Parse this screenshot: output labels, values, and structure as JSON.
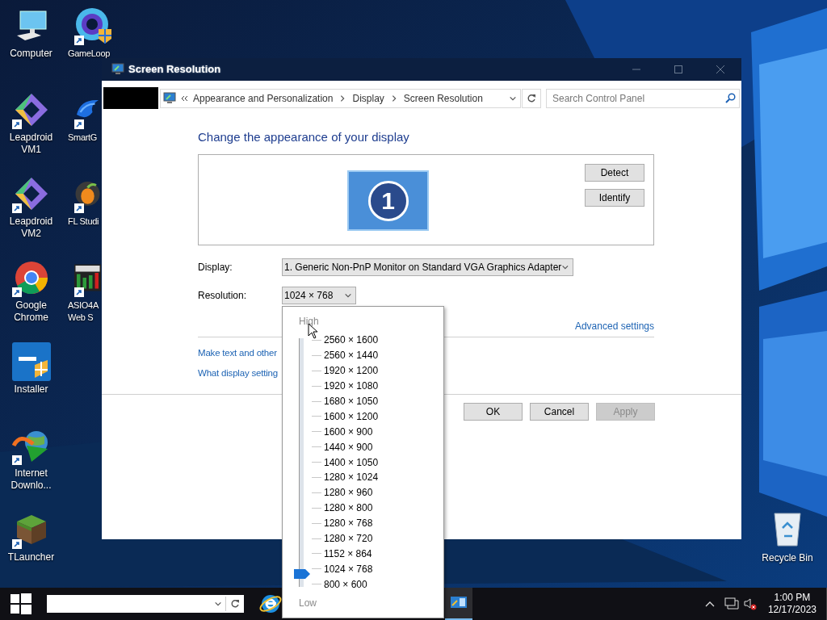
{
  "desktop": {
    "columns": [
      {
        "icons": [
          {
            "label": "Computer",
            "kind": "computer",
            "shortcut": false
          },
          {
            "label": "Leapdroid VM1",
            "kind": "leapdroid",
            "shortcut": true
          },
          {
            "label": "Leapdroid VM2",
            "kind": "leapdroid",
            "shortcut": true
          },
          {
            "label": "Google Chrome",
            "kind": "chrome",
            "shortcut": true
          },
          {
            "label": "Installer",
            "kind": "intel",
            "shortcut": false
          },
          {
            "label": "Internet Downlo...",
            "kind": "idm",
            "shortcut": true
          },
          {
            "label": "TLauncher",
            "kind": "block",
            "shortcut": true
          }
        ]
      },
      {
        "icons": [
          {
            "label": "GameLoop",
            "kind": "gameloop",
            "shortcut": true
          },
          {
            "label": "SmartG",
            "kind": "bird",
            "shortcut": true
          },
          {
            "label": "FL Studi",
            "kind": "fruit",
            "shortcut": true
          },
          {
            "label": "ASIO4A",
            "label_2": "Web S",
            "kind": "meter",
            "shortcut": true
          }
        ]
      }
    ],
    "recycle_bin": {
      "label": "Recycle Bin"
    }
  },
  "window": {
    "title": "Screen Resolution",
    "address": {
      "breadcrumbs": [
        "Appearance and Personalization",
        "Display",
        "Screen Resolution"
      ],
      "search_placeholder": "Search Control Panel"
    },
    "heading": "Change the appearance of your display",
    "preview_buttons": [
      "Detect",
      "Identify"
    ],
    "monitor_number": "1",
    "display": {
      "label": "Display:",
      "value": "1. Generic Non-PnP Monitor on Standard VGA Graphics Adapter"
    },
    "resolution": {
      "label": "Resolution:",
      "value": "1024 × 768"
    },
    "advanced_link": "Advanced settings",
    "links": [
      "Make text and other",
      "What display setting"
    ],
    "buttons": [
      {
        "label": "OK",
        "disabled": false
      },
      {
        "label": "Cancel",
        "disabled": false
      },
      {
        "label": "Apply",
        "disabled": true
      }
    ]
  },
  "resolution_slider": {
    "high_label": "High",
    "low_label": "Low",
    "level": 0.067,
    "options": [
      "2560 × 1600",
      "2560 × 1440",
      "1920 × 1200",
      "1920 × 1080",
      "1680 × 1050",
      "1600 × 1200",
      "1600 × 900",
      "1440 × 900",
      "1400 × 1050",
      "1280 × 1024",
      "1280 × 960",
      "1280 × 800",
      "1280 × 768",
      "1280 × 720",
      "1152 × 864",
      "1024 × 768",
      "800 × 600"
    ]
  },
  "taskbar": {
    "time": "1:00 PM",
    "date": "12/17/2023"
  }
}
